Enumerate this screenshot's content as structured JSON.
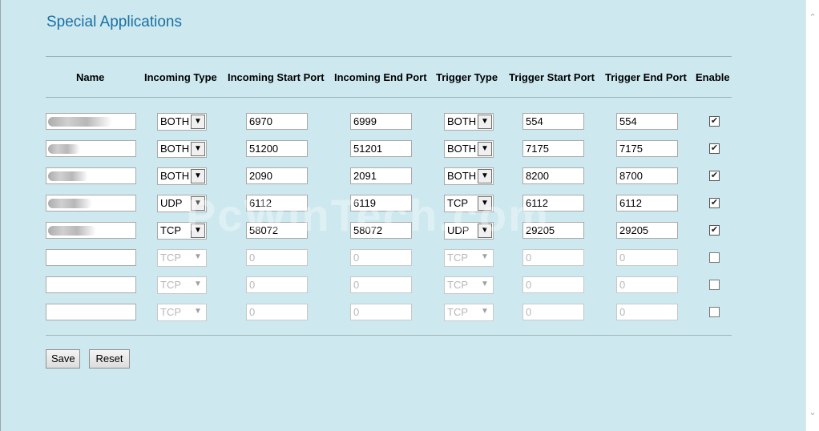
{
  "page": {
    "title": "Special Applications"
  },
  "columns": {
    "name": "Name",
    "incoming_type": "Incoming Type",
    "incoming_start": "Incoming Start Port",
    "incoming_end": "Incoming End Port",
    "trigger_type": "Trigger Type",
    "trigger_start": "Trigger Start Port",
    "trigger_end": "Trigger End Port",
    "enable": "Enable"
  },
  "rows": [
    {
      "name": "",
      "incoming_type": "BOTH",
      "incoming_start": "6970",
      "incoming_end": "6999",
      "trigger_type": "BOTH",
      "trigger_start": "554",
      "trigger_end": "554",
      "enabled": true,
      "disabled_fields": false
    },
    {
      "name": "",
      "incoming_type": "BOTH",
      "incoming_start": "51200",
      "incoming_end": "51201",
      "trigger_type": "BOTH",
      "trigger_start": "7175",
      "trigger_end": "7175",
      "enabled": true,
      "disabled_fields": false
    },
    {
      "name": "",
      "incoming_type": "BOTH",
      "incoming_start": "2090",
      "incoming_end": "2091",
      "trigger_type": "BOTH",
      "trigger_start": "8200",
      "trigger_end": "8700",
      "enabled": true,
      "disabled_fields": false
    },
    {
      "name": "",
      "incoming_type": "UDP",
      "incoming_start": "6112",
      "incoming_end": "6119",
      "trigger_type": "TCP",
      "trigger_start": "6112",
      "trigger_end": "6112",
      "enabled": true,
      "disabled_fields": false
    },
    {
      "name": "",
      "incoming_type": "TCP",
      "incoming_start": "58072",
      "incoming_end": "58072",
      "trigger_type": "UDP",
      "trigger_start": "29205",
      "trigger_end": "29205",
      "enabled": true,
      "disabled_fields": false
    },
    {
      "name": "",
      "incoming_type": "TCP",
      "incoming_start": "0",
      "incoming_end": "0",
      "trigger_type": "TCP",
      "trigger_start": "0",
      "trigger_end": "0",
      "enabled": false,
      "disabled_fields": true
    },
    {
      "name": "",
      "incoming_type": "TCP",
      "incoming_start": "0",
      "incoming_end": "0",
      "trigger_type": "TCP",
      "trigger_start": "0",
      "trigger_end": "0",
      "enabled": false,
      "disabled_fields": true
    },
    {
      "name": "",
      "incoming_type": "TCP",
      "incoming_start": "0",
      "incoming_end": "0",
      "trigger_type": "TCP",
      "trigger_start": "0",
      "trigger_end": "0",
      "enabled": false,
      "disabled_fields": true
    }
  ],
  "buttons": {
    "save": "Save",
    "reset": "Reset"
  },
  "watermark": "PcWinTech.com",
  "icons": {
    "dropdown": "chevron-down-icon",
    "checkbox_checked": "checkmark-icon",
    "scroll_up": "chevron-up-icon",
    "scroll_down": "chevron-down-icon"
  },
  "colors": {
    "background": "#cde9ef",
    "title": "#1a6fa4"
  }
}
